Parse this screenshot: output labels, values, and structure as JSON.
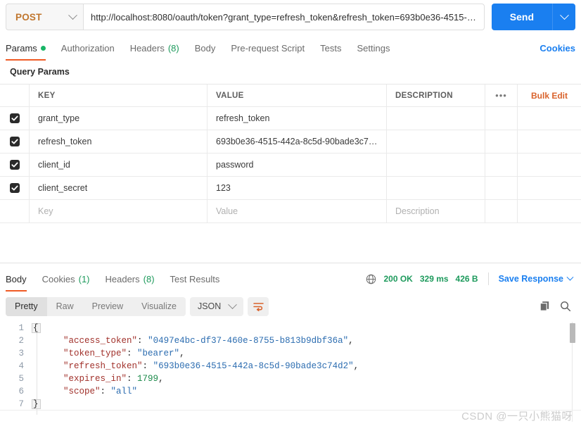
{
  "request": {
    "method": "POST",
    "url": "http://localhost:8080/oauth/token?grant_type=refresh_token&refresh_token=693b0e36-4515-44…",
    "send_label": "Send",
    "method_caret_icon": "chevron-down-icon",
    "send_caret_icon": "chevron-down-icon"
  },
  "request_tabs": [
    {
      "label": "Params",
      "badge": "",
      "has_dot": true,
      "active": true
    },
    {
      "label": "Authorization",
      "badge": "",
      "has_dot": false,
      "active": false
    },
    {
      "label": "Headers",
      "badge": "(8)",
      "has_dot": false,
      "active": false
    },
    {
      "label": "Body",
      "badge": "",
      "has_dot": false,
      "active": false
    },
    {
      "label": "Pre-request Script",
      "badge": "",
      "has_dot": false,
      "active": false
    },
    {
      "label": "Tests",
      "badge": "",
      "has_dot": false,
      "active": false
    },
    {
      "label": "Settings",
      "badge": "",
      "has_dot": false,
      "active": false
    }
  ],
  "cookies_link": "Cookies",
  "params": {
    "section_title": "Query Params",
    "columns": {
      "key": "KEY",
      "value": "VALUE",
      "description": "DESCRIPTION"
    },
    "more_icon": "ellipsis-icon",
    "bulk_edit": "Bulk Edit",
    "rows": [
      {
        "checked": true,
        "key": "grant_type",
        "value": "refresh_token",
        "description": ""
      },
      {
        "checked": true,
        "key": "refresh_token",
        "value": "693b0e36-4515-442a-8c5d-90bade3c7…",
        "description": ""
      },
      {
        "checked": true,
        "key": "client_id",
        "value": "password",
        "description": ""
      },
      {
        "checked": true,
        "key": "client_secret",
        "value": "123",
        "description": ""
      }
    ],
    "placeholder_row": {
      "key": "Key",
      "value": "Value",
      "description": "Description"
    }
  },
  "response_tabs": [
    {
      "label": "Body",
      "badge": "",
      "active": true
    },
    {
      "label": "Cookies",
      "badge": "(1)",
      "active": false
    },
    {
      "label": "Headers",
      "badge": "(8)",
      "active": false
    },
    {
      "label": "Test Results",
      "badge": "",
      "active": false
    }
  ],
  "response_meta": {
    "network_icon": "globe-icon",
    "status": "200 OK",
    "time": "329 ms",
    "size": "426 B",
    "save_response": "Save Response",
    "save_caret_icon": "chevron-down-icon"
  },
  "body_toolbar": {
    "views": [
      {
        "label": "Pretty",
        "active": true
      },
      {
        "label": "Raw",
        "active": false
      },
      {
        "label": "Preview",
        "active": false
      },
      {
        "label": "Visualize",
        "active": false
      }
    ],
    "format": "JSON",
    "format_caret_icon": "chevron-down-icon",
    "wrap_icon": "wrap-lines-icon",
    "copy_icon": "copy-icon",
    "search_icon": "search-icon"
  },
  "code": {
    "lines": [
      {
        "num": "1",
        "tokens": [
          {
            "t": "p",
            "v": "{"
          }
        ]
      },
      {
        "num": "2",
        "tokens": [
          {
            "t": "p",
            "v": "    "
          },
          {
            "t": "k",
            "v": "\"access_token\""
          },
          {
            "t": "p",
            "v": ": "
          },
          {
            "t": "s",
            "v": "\"0497e4bc-df37-460e-8755-b813b9dbf36a\""
          },
          {
            "t": "p",
            "v": ","
          }
        ]
      },
      {
        "num": "3",
        "tokens": [
          {
            "t": "p",
            "v": "    "
          },
          {
            "t": "k",
            "v": "\"token_type\""
          },
          {
            "t": "p",
            "v": ": "
          },
          {
            "t": "s",
            "v": "\"bearer\""
          },
          {
            "t": "p",
            "v": ","
          }
        ]
      },
      {
        "num": "4",
        "tokens": [
          {
            "t": "p",
            "v": "    "
          },
          {
            "t": "k",
            "v": "\"refresh_token\""
          },
          {
            "t": "p",
            "v": ": "
          },
          {
            "t": "s",
            "v": "\"693b0e36-4515-442a-8c5d-90bade3c74d2\""
          },
          {
            "t": "p",
            "v": ","
          }
        ]
      },
      {
        "num": "5",
        "tokens": [
          {
            "t": "p",
            "v": "    "
          },
          {
            "t": "k",
            "v": "\"expires_in\""
          },
          {
            "t": "p",
            "v": ": "
          },
          {
            "t": "n",
            "v": "1799"
          },
          {
            "t": "p",
            "v": ","
          }
        ]
      },
      {
        "num": "6",
        "tokens": [
          {
            "t": "p",
            "v": "    "
          },
          {
            "t": "k",
            "v": "\"scope\""
          },
          {
            "t": "p",
            "v": ": "
          },
          {
            "t": "s",
            "v": "\"all\""
          }
        ]
      },
      {
        "num": "7",
        "tokens": [
          {
            "t": "p",
            "v": "}"
          }
        ]
      }
    ]
  },
  "watermark": "CSDN @一只小熊猫呀",
  "colors": {
    "accent_blue": "#1a7ff0",
    "accent_orange": "#ef5b25",
    "method_orange": "#c0762e",
    "status_green": "#1d9a5c",
    "bulk_orange": "#d9622b"
  }
}
